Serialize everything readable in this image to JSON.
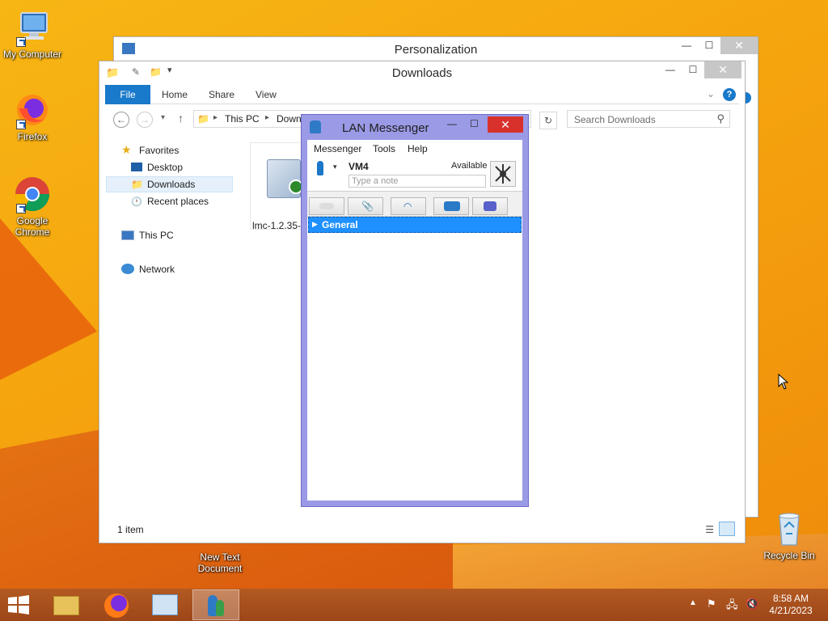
{
  "desktop": {
    "icons": [
      {
        "label": "My Computer"
      },
      {
        "label": "Firefox"
      },
      {
        "label": "Google Chrome"
      },
      {
        "label": "New Text Document"
      },
      {
        "label": "Recycle Bin"
      }
    ]
  },
  "personalization": {
    "title": "Personalization"
  },
  "explorer": {
    "title": "Downloads",
    "tabs": [
      "File",
      "Home",
      "Share",
      "View"
    ],
    "address": {
      "crumb1": "This PC",
      "crumb2": "Down"
    },
    "search_placeholder": "Search Downloads",
    "sidebar": {
      "favorites": "Favorites",
      "desktop": "Desktop",
      "downloads": "Downloads",
      "recent": "Recent places",
      "this_pc": "This PC",
      "network": "Network"
    },
    "file": {
      "name": "lmc-1.2.35-"
    },
    "status": "1 item"
  },
  "lan": {
    "title": "LAN Messenger",
    "menu": [
      "Messenger",
      "Tools",
      "Help"
    ],
    "user": "VM4",
    "status": "Available",
    "note_placeholder": "Type a note",
    "group": "General"
  },
  "clock": {
    "time": "8:58 AM",
    "date": "4/21/2023"
  },
  "colors": {
    "accent": "#1979ca",
    "lan_frame": "#9a9ae6",
    "taskbar": "#a84e1a",
    "selection": "#1e90ff"
  }
}
